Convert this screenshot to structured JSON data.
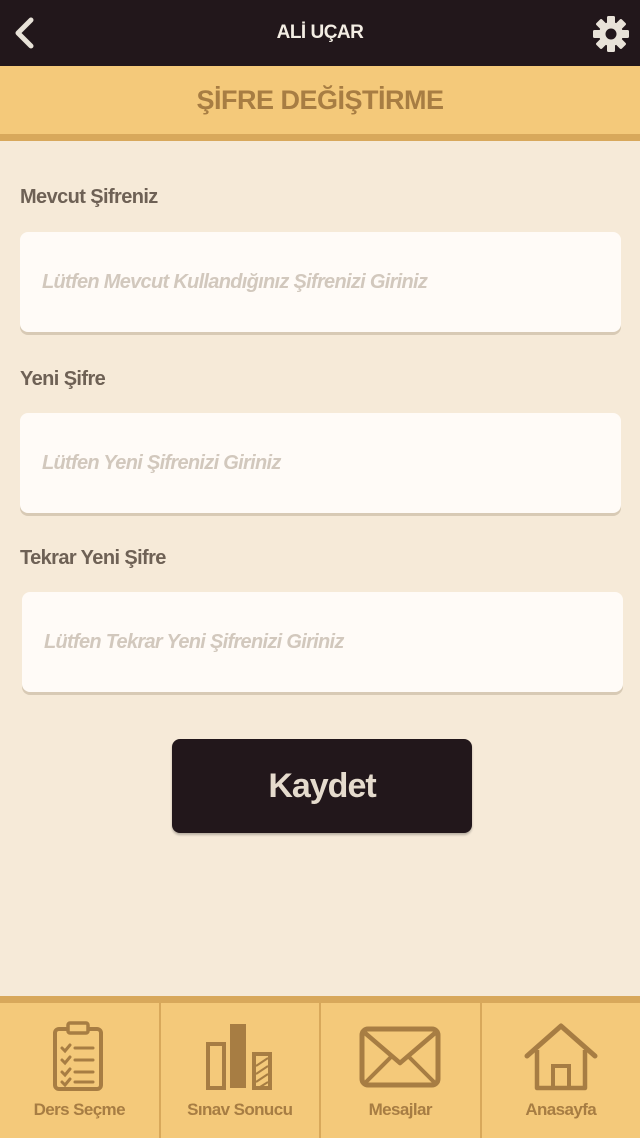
{
  "header": {
    "title": "ALİ UÇAR",
    "back_icon": "chevron-left-icon",
    "settings_icon": "gear-icon"
  },
  "section": {
    "title": "ŞİFRE DEĞİŞTİRME"
  },
  "form": {
    "current_password": {
      "label": "Mevcut Şifreniz",
      "placeholder": "Lütfen Mevcut Kullandığınız Şifrenizi Giriniz",
      "value": ""
    },
    "new_password": {
      "label": "Yeni Şifre",
      "placeholder": "Lütfen Yeni Şifrenizi Giriniz",
      "value": ""
    },
    "repeat_password": {
      "label": "Tekrar Yeni Şifre",
      "placeholder": "Lütfen Tekrar Yeni Şifrenizi Giriniz",
      "value": ""
    },
    "save_label": "Kaydet"
  },
  "bottom_nav": {
    "items": [
      {
        "label": "Ders Seçme",
        "icon": "clipboard-checklist-icon"
      },
      {
        "label": "Sınav Sonucu",
        "icon": "bar-chart-icon"
      },
      {
        "label": "Mesajlar",
        "icon": "envelope-icon"
      },
      {
        "label": "Anasayfa",
        "icon": "home-icon"
      }
    ]
  },
  "colors": {
    "topbar_bg": "#22171b",
    "accent": "#f4c97a",
    "accent_dark": "#d8a85b",
    "accent_text": "#a77d43",
    "page_bg": "#f6ead8"
  }
}
